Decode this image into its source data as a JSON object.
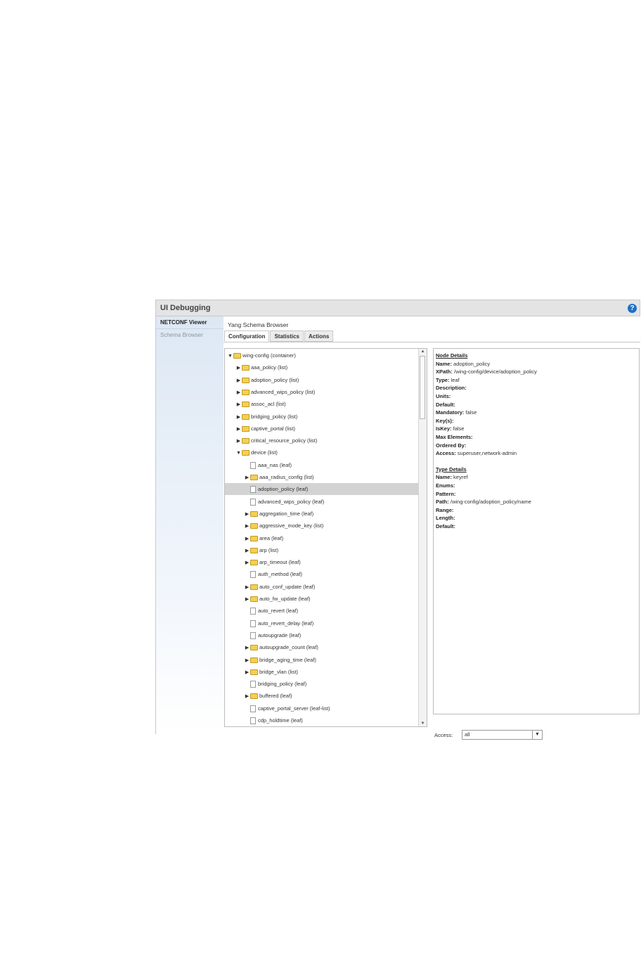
{
  "window": {
    "title": "UI Debugging",
    "help_icon": "?"
  },
  "sidebar": {
    "items": [
      {
        "label": "NETCONF Viewer",
        "state": "active"
      },
      {
        "label": "Schema Browser",
        "state": "inactive"
      }
    ]
  },
  "main": {
    "title": "Yang Schema Browser",
    "tabs": [
      {
        "label": "Configuration"
      },
      {
        "label": "Statistics"
      },
      {
        "label": "Actions"
      }
    ]
  },
  "tree": {
    "rows": [
      {
        "label": "wing-config (container)",
        "depth": 0,
        "expander": "▼",
        "icon": "open-folder"
      },
      {
        "label": "aaa_policy (list)",
        "depth": 1,
        "expander": "▶",
        "icon": "folder"
      },
      {
        "label": "adoption_policy (list)",
        "depth": 1,
        "expander": "▶",
        "icon": "folder"
      },
      {
        "label": "advanced_wips_policy (list)",
        "depth": 1,
        "expander": "▶",
        "icon": "folder"
      },
      {
        "label": "assoc_acl (list)",
        "depth": 1,
        "expander": "▶",
        "icon": "folder"
      },
      {
        "label": "bridging_policy (list)",
        "depth": 1,
        "expander": "▶",
        "icon": "folder"
      },
      {
        "label": "captive_portal (list)",
        "depth": 1,
        "expander": "▶",
        "icon": "folder"
      },
      {
        "label": "critical_resource_policy (list)",
        "depth": 1,
        "expander": "▶",
        "icon": "folder"
      },
      {
        "label": "device (list)",
        "depth": 1,
        "expander": "▼",
        "icon": "open-folder"
      },
      {
        "label": "aaa_nas (leaf)",
        "depth": 2,
        "expander": "",
        "icon": "file"
      },
      {
        "label": "aaa_radius_config (list)",
        "depth": 2,
        "expander": "▶",
        "icon": "folder"
      },
      {
        "label": "adoption_policy (leaf)",
        "depth": 2,
        "expander": "",
        "icon": "file",
        "selected": true
      },
      {
        "label": "advanced_wips_policy (leaf)",
        "depth": 2,
        "expander": "",
        "icon": "file"
      },
      {
        "label": "aggregation_time (leaf)",
        "depth": 2,
        "expander": "▶",
        "icon": "folder"
      },
      {
        "label": "aggressive_mode_key (list)",
        "depth": 2,
        "expander": "▶",
        "icon": "folder"
      },
      {
        "label": "area (leaf)",
        "depth": 2,
        "expander": "▶",
        "icon": "folder"
      },
      {
        "label": "arp (list)",
        "depth": 2,
        "expander": "▶",
        "icon": "folder"
      },
      {
        "label": "arp_timeout (leaf)",
        "depth": 2,
        "expander": "▶",
        "icon": "folder"
      },
      {
        "label": "auth_method (leaf)",
        "depth": 2,
        "expander": "",
        "icon": "file"
      },
      {
        "label": "auto_conf_update (leaf)",
        "depth": 2,
        "expander": "▶",
        "icon": "folder"
      },
      {
        "label": "auto_fw_update (leaf)",
        "depth": 2,
        "expander": "▶",
        "icon": "folder"
      },
      {
        "label": "auto_revert (leaf)",
        "depth": 2,
        "expander": "",
        "icon": "file"
      },
      {
        "label": "auto_revert_delay (leaf)",
        "depth": 2,
        "expander": "",
        "icon": "file"
      },
      {
        "label": "autoupgrade (leaf)",
        "depth": 2,
        "expander": "",
        "icon": "file"
      },
      {
        "label": "autoupgrade_count (leaf)",
        "depth": 2,
        "expander": "▶",
        "icon": "folder"
      },
      {
        "label": "bridge_aging_time (leaf)",
        "depth": 2,
        "expander": "▶",
        "icon": "folder"
      },
      {
        "label": "bridge_vlan (list)",
        "depth": 2,
        "expander": "▶",
        "icon": "folder"
      },
      {
        "label": "bridging_policy (leaf)",
        "depth": 2,
        "expander": "",
        "icon": "file"
      },
      {
        "label": "buffered (leaf)",
        "depth": 2,
        "expander": "▶",
        "icon": "folder"
      },
      {
        "label": "captive_portal_server (leaf-list)",
        "depth": 2,
        "expander": "",
        "icon": "file"
      },
      {
        "label": "cdp_holdtime (leaf)",
        "depth": 2,
        "expander": "",
        "icon": "file"
      }
    ]
  },
  "node_details": {
    "heading": "Node Details",
    "lines": [
      {
        "key": "Name",
        "value": "adoption_policy"
      },
      {
        "key": "XPath",
        "value": "/wing-config/device/adoption_policy"
      },
      {
        "key": "Type",
        "value": "leaf"
      },
      {
        "key": "Description",
        "value": ""
      },
      {
        "key": "Units",
        "value": ""
      },
      {
        "key": "Default",
        "value": ""
      },
      {
        "key": "Mandatory",
        "value": "false"
      },
      {
        "key": "Key(s)",
        "value": ""
      },
      {
        "key": "IsKey",
        "value": "false"
      },
      {
        "key": "Max Elements",
        "value": ""
      },
      {
        "key": "Ordered By",
        "value": ""
      },
      {
        "key": "Access",
        "value": "superuser,network-admin"
      }
    ]
  },
  "type_details": {
    "heading": "Type Details",
    "lines": [
      {
        "key": "Name",
        "value": "keyref"
      },
      {
        "key": "Enums",
        "value": ""
      },
      {
        "key": "Pattern",
        "value": ""
      },
      {
        "key": "Path",
        "value": "/wing-config/adoption_policy/name"
      },
      {
        "key": "Range",
        "value": ""
      },
      {
        "key": "Length",
        "value": ""
      },
      {
        "key": "Default",
        "value": ""
      }
    ]
  },
  "access_filter": {
    "label": "Access:",
    "value": "all"
  }
}
